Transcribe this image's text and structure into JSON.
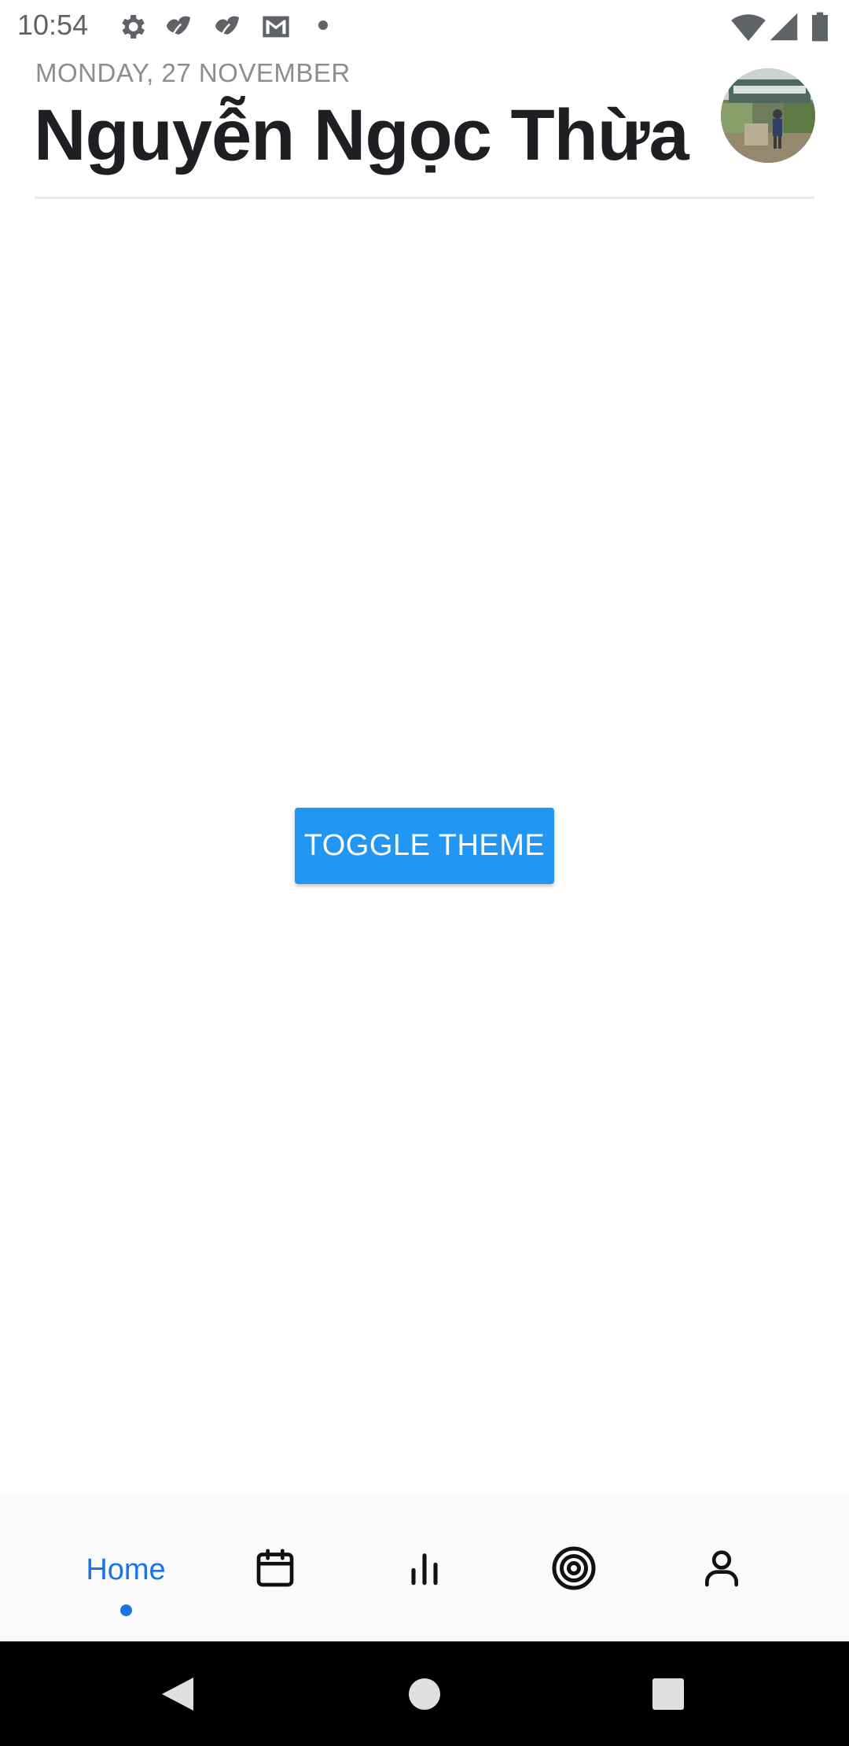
{
  "status_bar": {
    "time": "10:54",
    "left_icons": [
      "settings-icon",
      "leaf-icon",
      "leaf-icon",
      "gmail-icon",
      "notification-dot-icon"
    ],
    "right_icons": [
      "wifi-icon",
      "cellular-signal-icon",
      "battery-icon"
    ]
  },
  "header": {
    "date": "MONDAY, 27 NOVEMBER",
    "title": "Nguyễn Ngọc Thừa",
    "avatar_icon": "profile-photo"
  },
  "main": {
    "toggle_button_label": "TOGGLE THEME"
  },
  "tab_bar": {
    "tabs": [
      {
        "label": "Home",
        "icon": "home",
        "active": true
      },
      {
        "label": "",
        "icon": "calendar-icon",
        "active": false
      },
      {
        "label": "",
        "icon": "bar-chart-icon",
        "active": false
      },
      {
        "label": "",
        "icon": "target-icon",
        "active": false
      },
      {
        "label": "",
        "icon": "user-icon",
        "active": false
      }
    ]
  },
  "nav_bar": {
    "buttons": [
      "back-icon",
      "home-icon",
      "recents-icon"
    ]
  },
  "colors": {
    "accent": "#1a73e8",
    "button": "#2196f3",
    "title": "#1e1f23",
    "subtitle": "#8a8d91",
    "tab_bar_bg": "#fafafa",
    "nav_bar_bg": "#000000"
  }
}
